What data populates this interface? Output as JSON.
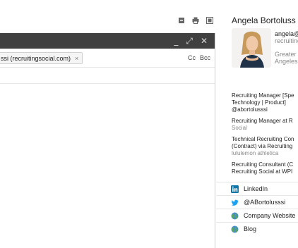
{
  "toolbar": {
    "icons": [
      "print-icon",
      "print-icon",
      "new-window-icon"
    ]
  },
  "compose": {
    "header_buttons": {
      "minimize": "_",
      "expand": "⤢",
      "close": "✕"
    },
    "to_chip": "ssi (recruitingsocial.com)",
    "chip_remove": "×",
    "cc": "Cc",
    "bcc": "Bcc"
  },
  "profile": {
    "name": "Angela Bortoluss",
    "email": "angela@",
    "company": "recruiting",
    "location_line1": "Greater",
    "location_line2": "Angeles",
    "jobs": [
      {
        "lines": [
          "Recruiting Manager [Spe",
          "Technology | Product]",
          "@abortolusssi"
        ],
        "muted": ""
      },
      {
        "lines": [
          "Recruiting Manager at R"
        ],
        "muted": "Social"
      },
      {
        "lines": [
          "Technical Recruiting Con",
          "(Contract) via Recruiting"
        ],
        "muted": "lululemon athletica"
      },
      {
        "lines": [
          "Recruiting Consultant (C",
          "Recruiting Social at WPI"
        ],
        "muted": ""
      }
    ],
    "links": [
      {
        "icon": "linkedin-icon",
        "label": "LinkedIn"
      },
      {
        "icon": "twitter-icon",
        "label": "@ABortolusssi"
      },
      {
        "icon": "globe-icon",
        "label": "Company Website"
      },
      {
        "icon": "globe-icon",
        "label": "Blog"
      }
    ]
  },
  "colors": {
    "header_bg": "#404040",
    "linkedin": "#0e76a8",
    "twitter": "#1da1f2",
    "globe": "#5aa85a"
  }
}
